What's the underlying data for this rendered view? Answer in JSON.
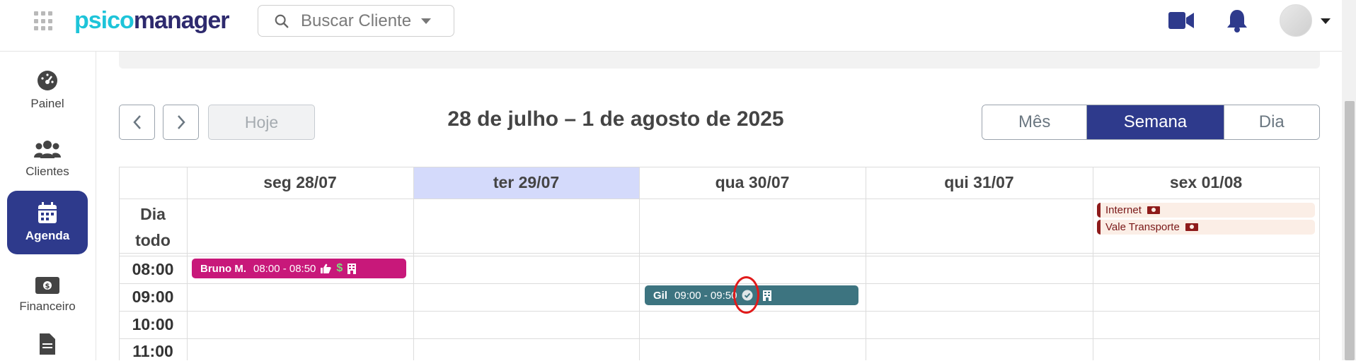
{
  "header": {
    "logo_part1": "psico",
    "logo_part2": "manager",
    "search_placeholder": "Buscar Cliente"
  },
  "sidebar": {
    "items": [
      {
        "label": "Painel",
        "icon": "gauge-icon",
        "active": false
      },
      {
        "label": "Clientes",
        "icon": "users-icon",
        "active": false
      },
      {
        "label": "Agenda",
        "icon": "calendar-icon",
        "active": true
      },
      {
        "label": "Financeiro",
        "icon": "money-icon",
        "active": false
      },
      {
        "label": "",
        "icon": "document-icon",
        "active": false
      }
    ]
  },
  "toolbar": {
    "today_label": "Hoje",
    "range_title": "28 de julho – 1 de agosto de 2025",
    "views": [
      {
        "label": "Mês",
        "active": false
      },
      {
        "label": "Semana",
        "active": true
      },
      {
        "label": "Dia",
        "active": false
      }
    ]
  },
  "calendar": {
    "allday_label_1": "Dia",
    "allday_label_2": "todo",
    "days": [
      "seg 28/07",
      "ter 29/07",
      "qua 30/07",
      "qui 31/07",
      "sex 01/08"
    ],
    "today_index": 1,
    "times": [
      "08:00",
      "09:00",
      "10:00",
      "11:00"
    ],
    "allday_events": [
      {
        "day": "sex 01/08",
        "title": "Internet"
      },
      {
        "day": "sex 01/08",
        "title": "Vale Transporte"
      }
    ],
    "events": [
      {
        "day": "seg 28/07",
        "name": "Bruno M.",
        "time": "08:00 - 08:50",
        "color": "#c8187a",
        "icons": [
          "thumbs-up-icon",
          "dollar-icon",
          "building-icon"
        ]
      },
      {
        "day": "qua 30/07",
        "name": "Gil",
        "time": "09:00 - 09:50",
        "color": "#3d7480",
        "icons": [
          "check-circle-icon",
          "building-icon"
        ]
      }
    ]
  },
  "colors": {
    "primary": "#2e3a8c",
    "today_bg": "#d4dafb",
    "logo_cyan": "#1ec4d9",
    "logo_navy": "#2e2a6e"
  }
}
